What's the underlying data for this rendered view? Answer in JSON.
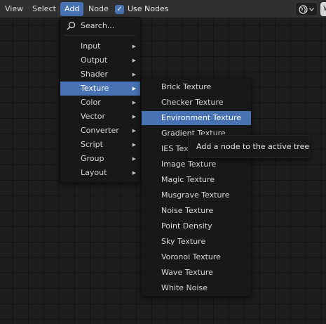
{
  "header": {
    "menus": [
      {
        "label": "View"
      },
      {
        "label": "Select"
      },
      {
        "label": "Add"
      },
      {
        "label": "Node"
      }
    ],
    "use_nodes_label": "Use Nodes",
    "use_nodes_checked": true,
    "accent_color": "#4772b3",
    "shading_icon": "globe-icon",
    "edge_button_label": "W"
  },
  "add_menu": {
    "search_label": "Search...",
    "items": [
      {
        "label": "Input",
        "has_submenu": true
      },
      {
        "label": "Output",
        "has_submenu": true
      },
      {
        "label": "Shader",
        "has_submenu": true
      },
      {
        "label": "Texture",
        "has_submenu": true,
        "highlighted": true
      },
      {
        "label": "Color",
        "has_submenu": true
      },
      {
        "label": "Vector",
        "has_submenu": true
      },
      {
        "label": "Converter",
        "has_submenu": true
      },
      {
        "label": "Script",
        "has_submenu": true
      },
      {
        "label": "Group",
        "has_submenu": true
      },
      {
        "label": "Layout",
        "has_submenu": true
      }
    ]
  },
  "texture_menu": {
    "items": [
      {
        "label": "Brick Texture"
      },
      {
        "label": "Checker Texture"
      },
      {
        "label": "Environment Texture",
        "highlighted": true
      },
      {
        "label": "Gradient Texture"
      },
      {
        "label": "IES Texture"
      },
      {
        "label": "Image Texture"
      },
      {
        "label": "Magic Texture"
      },
      {
        "label": "Musgrave Texture"
      },
      {
        "label": "Noise Texture"
      },
      {
        "label": "Point Density"
      },
      {
        "label": "Sky Texture"
      },
      {
        "label": "Voronoi Texture"
      },
      {
        "label": "Wave Texture"
      },
      {
        "label": "White Noise"
      }
    ]
  },
  "tooltip": {
    "text": "Add a node to the active tree."
  }
}
